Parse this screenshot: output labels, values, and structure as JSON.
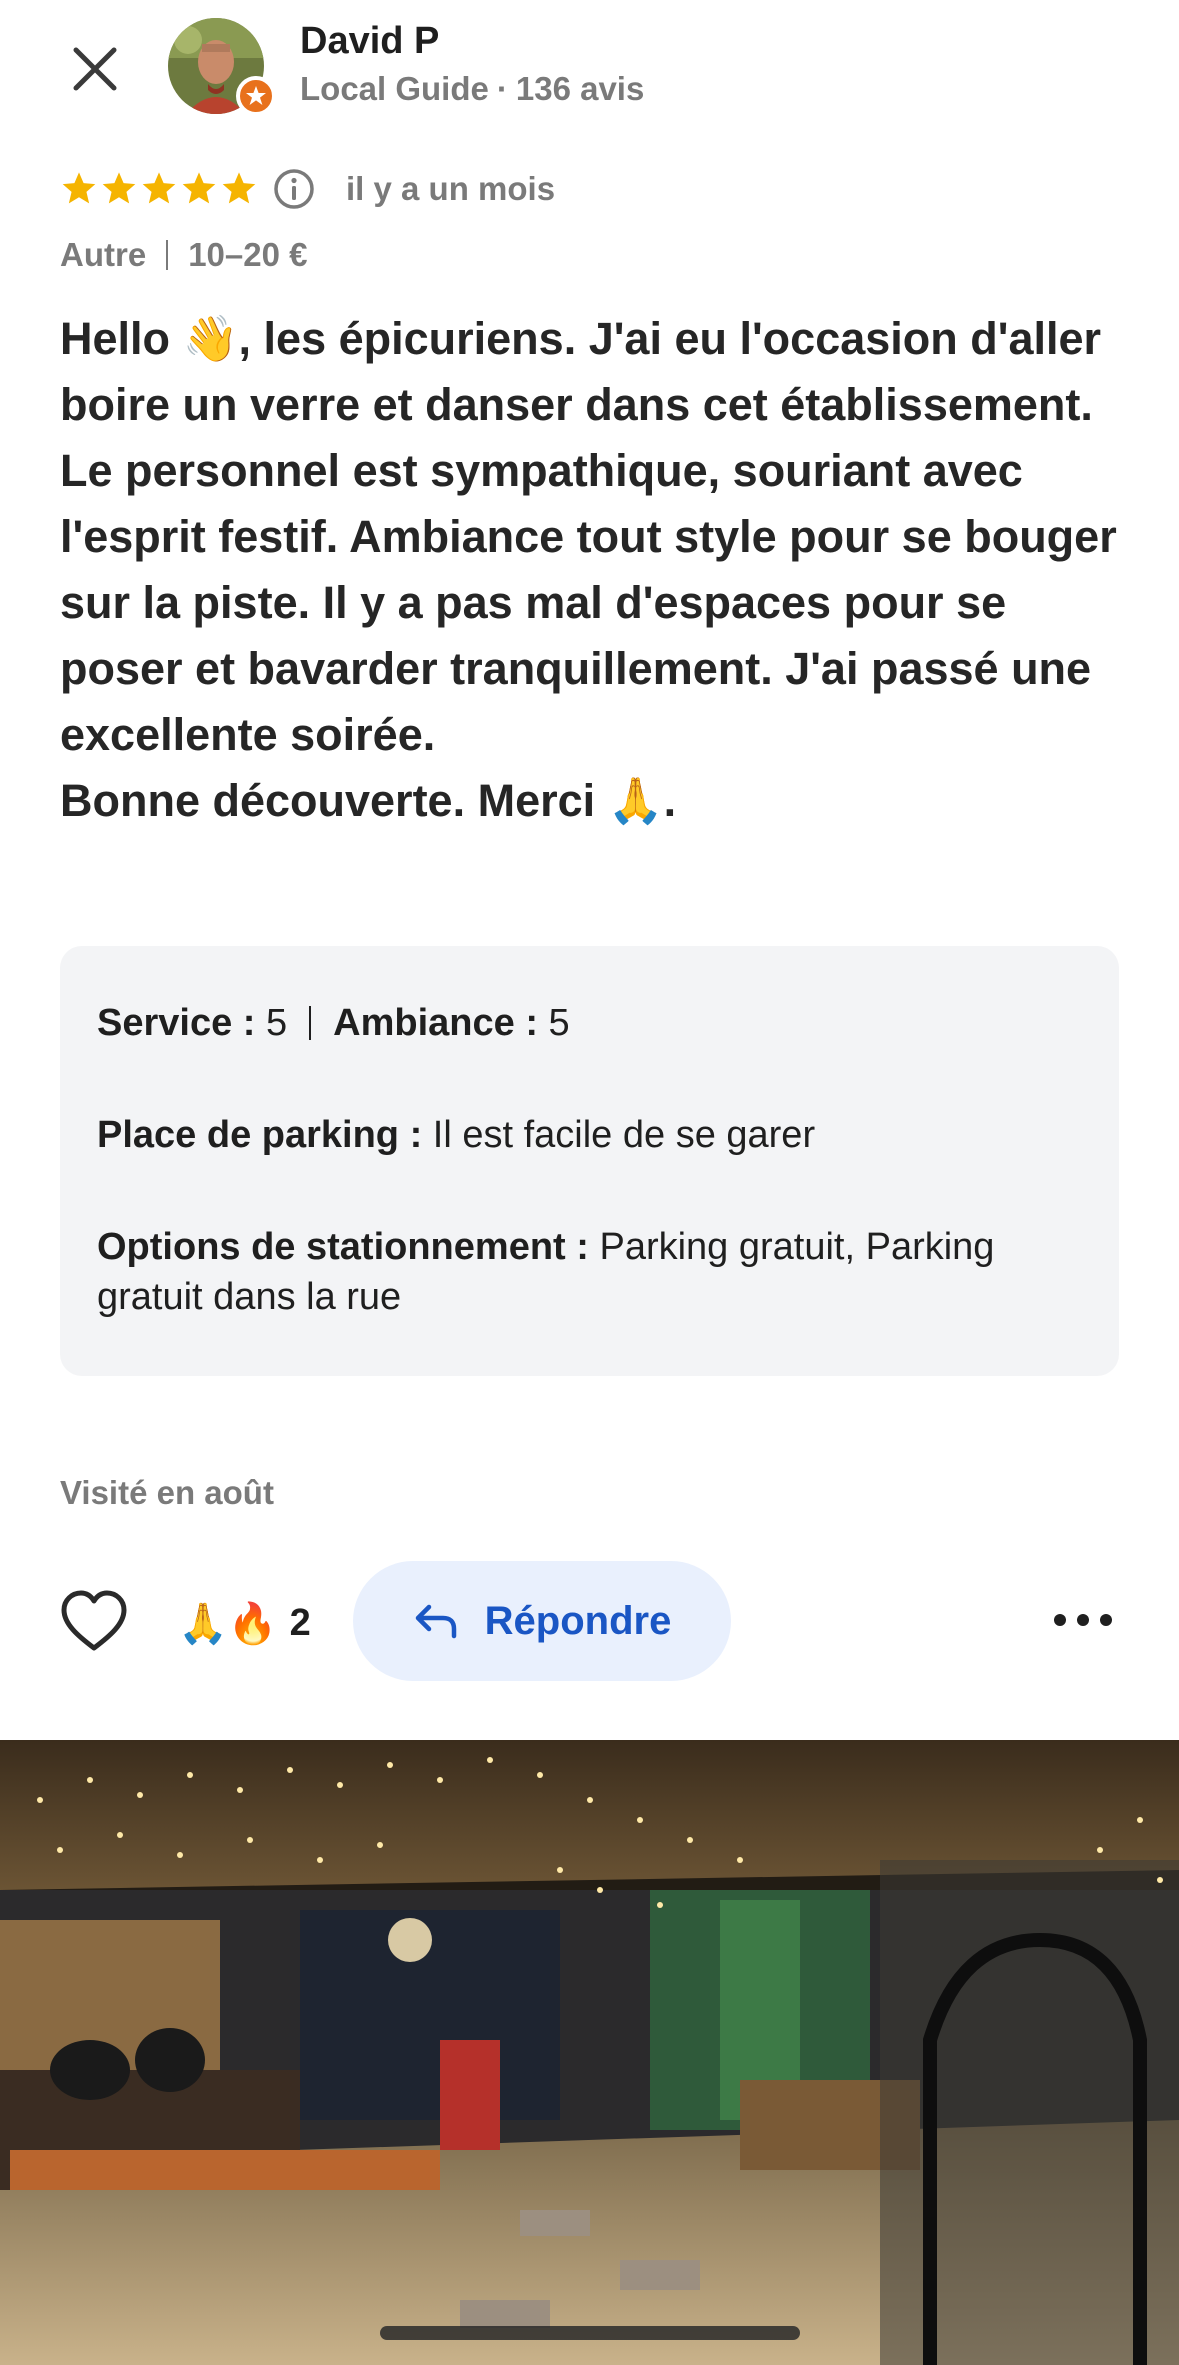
{
  "header": {
    "user_name": "David P",
    "guide_label": "Local Guide",
    "separator": "·",
    "review_count": "136 avis"
  },
  "rating": {
    "stars": 5,
    "max_stars": 5,
    "time_ago": "il y a un mois"
  },
  "meta": {
    "category": "Autre",
    "price": "10–20 €"
  },
  "review": {
    "text": "Hello 👋, les épicuriens. J'ai eu l'occasion d'aller boire un verre et danser dans cet établissement. Le personnel est sympathique, souriant avec l'esprit festif. Ambiance tout style pour se bouger sur la piste. Il y a pas mal d'espaces pour se poser et bavarder tranquillement. J'ai passé une excellente soirée.\nBonne découverte. Merci 🙏."
  },
  "details": {
    "service_label": "Service :",
    "service_value": "5",
    "ambiance_label": "Ambiance :",
    "ambiance_value": "5",
    "parking_label": "Place de parking :",
    "parking_value": "Il est facile de se garer",
    "options_label": "Options de stationnement :",
    "options_value": "Parking gratuit, Parking gratuit dans la rue"
  },
  "visited": "Visité en août",
  "actions": {
    "reactions_emoji": "🙏🔥",
    "reactions_count": "2",
    "reply_label": "Répondre"
  },
  "colors": {
    "star": "#f5b400",
    "guide_badge": "#e8711c",
    "reply_bg": "#e9f0fd",
    "reply_text": "#1a56c4",
    "muted_text": "#7a7a7a",
    "details_bg": "#f3f4f6"
  }
}
